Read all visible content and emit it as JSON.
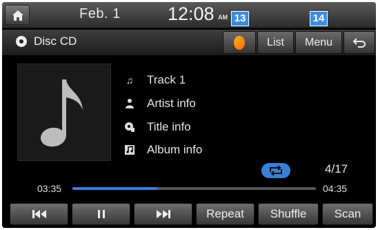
{
  "status": {
    "date": "Feb.  1",
    "time": "12:08",
    "ampm": "AM"
  },
  "callouts": {
    "first": "13",
    "second": "14"
  },
  "header": {
    "source_label": "Disc CD",
    "list_label": "List",
    "menu_label": "Menu"
  },
  "track": {
    "title": "Track 1",
    "artist": "Artist info",
    "title_info": "Title info",
    "album": "Album info"
  },
  "playback": {
    "count": "4/17",
    "current_time": "03:35",
    "total_time": "04:35",
    "progress": 0.35
  },
  "controls": {
    "repeat_label": "Repeat",
    "shuffle_label": "Shuffle",
    "scan_label": "Scan"
  },
  "icons": {
    "home": "home-icon",
    "disc": "disc-icon",
    "s_app": "s-app-icon",
    "back": "back-icon",
    "note": "music-note-icon",
    "artist": "person-icon",
    "title": "title-icon",
    "album": "album-icon",
    "repeat": "repeat-icon",
    "prev": "skip-back-icon",
    "pause": "pause-icon",
    "next": "skip-forward-icon"
  },
  "colors": {
    "accent": "#3a7fd6",
    "progress": "#3d7ee0",
    "callout": "#3a8de0"
  }
}
